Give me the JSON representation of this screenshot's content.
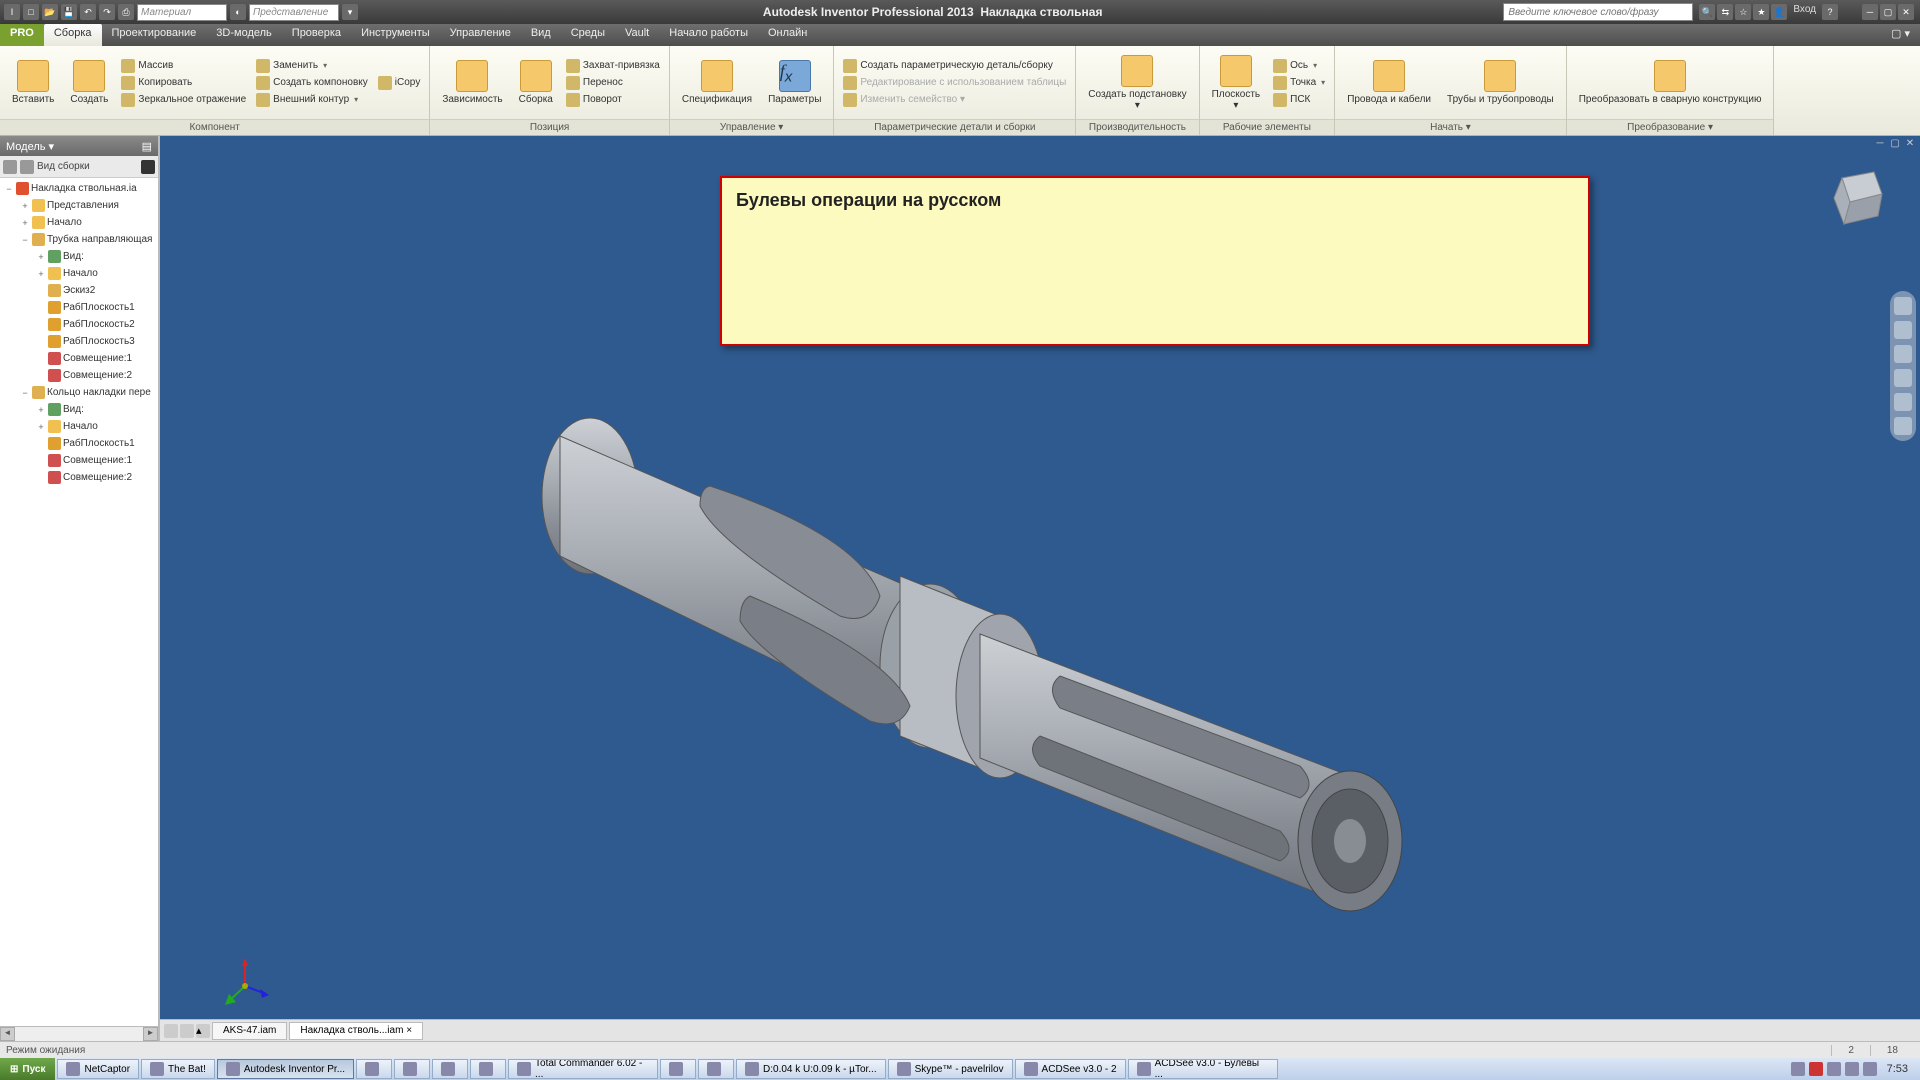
{
  "title_app": "Autodesk Inventor Professional 2013",
  "title_doc": "Накладка ствольная",
  "search_placeholder": "Введите ключевое слово/фразу",
  "signin": "Вход",
  "qat_material": "Материал",
  "qat_view": "Представление",
  "menutabs": {
    "file": "PRO",
    "items": [
      "Сборка",
      "Проектирование",
      "3D-модель",
      "Проверка",
      "Инструменты",
      "Управление",
      "Вид",
      "Среды",
      "Vault",
      "Начало работы",
      "Онлайн"
    ]
  },
  "ribbon": {
    "panels": [
      {
        "title": "Компонент",
        "big": [
          {
            "l": "Вставить"
          },
          {
            "l": "Создать"
          }
        ],
        "cols": [
          [
            {
              "l": "Массив"
            },
            {
              "l": "Копировать"
            },
            {
              "l": "Зеркальное отражение"
            }
          ],
          [
            {
              "l": "Заменить",
              "dd": true
            },
            {
              "l": "Создать компоновку"
            },
            {
              "l": "Внешний контур",
              "dd": true
            }
          ],
          [
            {
              "l": "iCopy"
            }
          ]
        ]
      },
      {
        "title": "Позиция",
        "big": [
          {
            "l": "Зависимость"
          },
          {
            "l": "Сборка"
          }
        ],
        "cols": [
          [
            {
              "l": "Захват-привязка"
            },
            {
              "l": "Перенос"
            },
            {
              "l": "Поворот"
            }
          ]
        ]
      },
      {
        "title": "Управление ▾",
        "big": [
          {
            "l": "Спецификация"
          },
          {
            "l": "Параметры",
            "ico": "fx"
          }
        ]
      },
      {
        "title": "Параметрические детали и сборки",
        "cols": [
          [
            {
              "l": "Создать параметрическую деталь/сборку"
            },
            {
              "l": "Редактирование с использованием таблицы",
              "dis": true
            },
            {
              "l": "Изменить семейство ▾",
              "dis": true
            }
          ]
        ]
      },
      {
        "title": "Производительность",
        "big": [
          {
            "l": "Создать подстановку",
            "dd": true
          }
        ]
      },
      {
        "title": "Рабочие элементы",
        "big": [
          {
            "l": "Плоскость",
            "dd": true
          }
        ],
        "cols": [
          [
            {
              "l": "Ось",
              "dd": true
            },
            {
              "l": "Точка",
              "dd": true
            },
            {
              "l": "ПСК"
            }
          ]
        ]
      },
      {
        "title": "Начать ▾",
        "big": [
          {
            "l": "Провода и кабели"
          },
          {
            "l": "Трубы и трубопроводы"
          }
        ]
      },
      {
        "title": "Преобразование ▾",
        "big": [
          {
            "l": "Преобразовать в сварную конструкцию"
          }
        ]
      }
    ]
  },
  "browser": {
    "title": "Модель ▾",
    "filter": "Вид сборки",
    "tree": [
      {
        "d": 0,
        "e": "−",
        "i": "top",
        "t": "Накладка ствольная.ia"
      },
      {
        "d": 1,
        "e": "+",
        "i": "folder",
        "t": "Представления"
      },
      {
        "d": 1,
        "e": "+",
        "i": "folder",
        "t": "Начало"
      },
      {
        "d": 1,
        "e": "−",
        "i": "part",
        "t": "Трубка направляющая"
      },
      {
        "d": 2,
        "e": "+",
        "i": "view",
        "t": "Вид:"
      },
      {
        "d": 2,
        "e": "+",
        "i": "folder",
        "t": "Начало"
      },
      {
        "d": 2,
        "e": "",
        "i": "sketch",
        "t": "Эскиз2"
      },
      {
        "d": 2,
        "e": "",
        "i": "plane",
        "t": "РабПлоскость1"
      },
      {
        "d": 2,
        "e": "",
        "i": "plane",
        "t": "РабПлоскость2"
      },
      {
        "d": 2,
        "e": "",
        "i": "plane",
        "t": "РабПлоскость3"
      },
      {
        "d": 2,
        "e": "",
        "i": "mate",
        "t": "Совмещение:1"
      },
      {
        "d": 2,
        "e": "",
        "i": "mate",
        "t": "Совмещение:2"
      },
      {
        "d": 1,
        "e": "−",
        "i": "part",
        "t": "Кольцо накладки пере"
      },
      {
        "d": 2,
        "e": "+",
        "i": "view",
        "t": "Вид:"
      },
      {
        "d": 2,
        "e": "+",
        "i": "folder",
        "t": "Начало"
      },
      {
        "d": 2,
        "e": "",
        "i": "plane",
        "t": "РабПлоскость1"
      },
      {
        "d": 2,
        "e": "",
        "i": "mate",
        "t": "Совмещение:1"
      },
      {
        "d": 2,
        "e": "",
        "i": "mate",
        "t": "Совмещение:2"
      }
    ]
  },
  "note": "Булевы операции на русском",
  "doctabs": [
    "AKS-47.iam",
    "Накладка стволь...iam ×"
  ],
  "status": "Режим ожидания",
  "status_nums": [
    "2",
    "18"
  ],
  "taskbar": {
    "start": "Пуск",
    "items": [
      "NetCaptor",
      "The Bat!",
      "Autodesk Inventor Pr...",
      "",
      "",
      "",
      "",
      "Total Commander 6.02 - ...",
      "",
      "",
      "D:0.04 k U:0.09 k - µTor...",
      "Skype™ - pavelrilov",
      "ACDSee v3.0 - 2",
      "ACDSee v3.0 - Булевы ..."
    ],
    "active": 2,
    "clock": "7:53"
  }
}
